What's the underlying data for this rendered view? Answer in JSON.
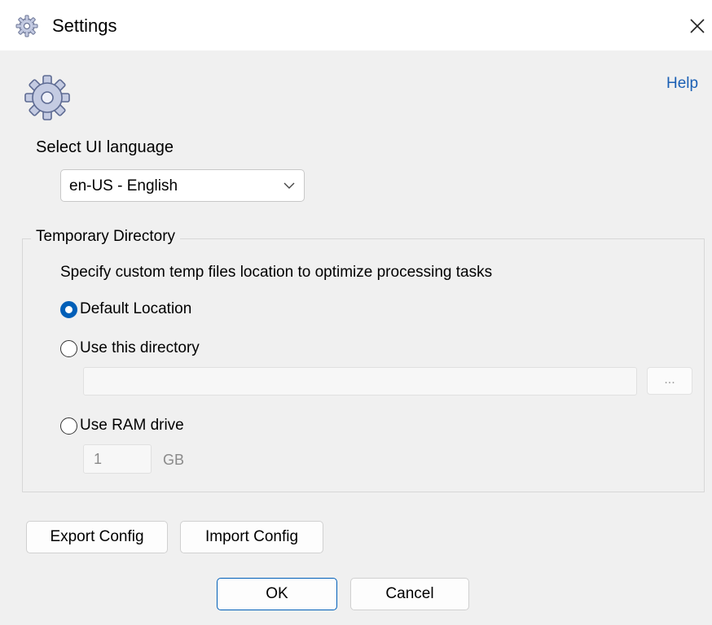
{
  "window": {
    "title": "Settings",
    "title_icon": "settings-gear-icon",
    "close_icon": "close-icon"
  },
  "header": {
    "icon": "settings-gear-icon",
    "help_label": "Help"
  },
  "language": {
    "label": "Select UI language",
    "selected": "en-US - English"
  },
  "temp_directory": {
    "legend": "Temporary Directory",
    "description": "Specify custom temp files location to optimize processing tasks",
    "options": [
      {
        "label": "Default Location",
        "checked": true
      },
      {
        "label": "Use this directory",
        "checked": false
      },
      {
        "label": "Use RAM drive",
        "checked": false
      }
    ],
    "directory_value": "",
    "browse_label": "...",
    "ram_size": "1",
    "ram_unit": "GB"
  },
  "config_buttons": {
    "export_label": "Export Config",
    "import_label": "Import Config"
  },
  "dialog_buttons": {
    "ok_label": "OK",
    "cancel_label": "Cancel"
  },
  "colors": {
    "accent": "#005fb8",
    "link": "#1a5fb4",
    "window_bg": "#f0f0f0",
    "titlebar_bg": "#ffffff",
    "disabled_text": "#8a8a8a"
  }
}
